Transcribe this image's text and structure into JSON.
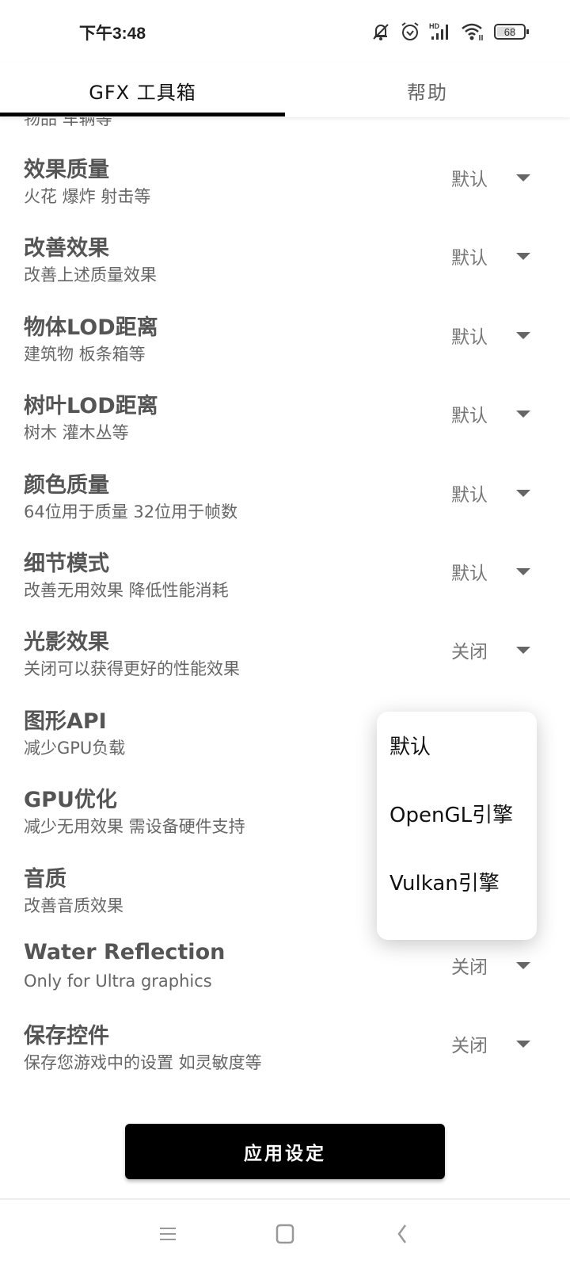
{
  "status_bar": {
    "time": "下午3:48",
    "icons": [
      "mute-bell-icon",
      "alarm-icon",
      "hd-signal-icon",
      "wifi-icon",
      "battery-icon"
    ],
    "signal_label": "HD",
    "battery_level": "68"
  },
  "tabs": [
    {
      "label": "GFX 工具箱",
      "active": true
    },
    {
      "label": "帮助",
      "active": false
    }
  ],
  "partial_row_text": "物品 车辆等",
  "settings": [
    {
      "title": "效果质量",
      "subtitle": "火花 爆炸 射击等",
      "value": "默认"
    },
    {
      "title": "改善效果",
      "subtitle": "改善上述质量效果",
      "value": "默认"
    },
    {
      "title": "物体LOD距离",
      "subtitle": "建筑物 板条箱等",
      "value": "默认"
    },
    {
      "title": "树叶LOD距离",
      "subtitle": "树木 灌木丛等",
      "value": "默认"
    },
    {
      "title": "颜色质量",
      "subtitle": "64位用于质量 32位用于帧数",
      "value": "默认"
    },
    {
      "title": "细节模式",
      "subtitle": "改善无用效果 降低性能消耗",
      "value": "默认"
    },
    {
      "title": "光影效果",
      "subtitle": "关闭可以获得更好的性能效果",
      "value": "关闭"
    },
    {
      "title": "图形API",
      "subtitle": "减少GPU负载",
      "value": ""
    },
    {
      "title": "GPU优化",
      "subtitle": "减少无用效果 需设备硬件支持",
      "value": ""
    },
    {
      "title": "音质",
      "subtitle": "改善音质效果",
      "value": ""
    },
    {
      "title": "Water Reflection",
      "subtitle": "Only for Ultra graphics",
      "value": "关闭"
    },
    {
      "title": "保存控件",
      "subtitle": "保存您游戏中的设置 如灵敏度等",
      "value": "关闭"
    }
  ],
  "dropdown_popup": {
    "for_setting": "图形API",
    "options": [
      "默认",
      "OpenGL引擎",
      "Vulkan引擎"
    ]
  },
  "apply_button": {
    "label": "应用设定"
  },
  "nav_bar": {
    "buttons": [
      "menu-icon",
      "home-icon",
      "back-icon"
    ]
  }
}
